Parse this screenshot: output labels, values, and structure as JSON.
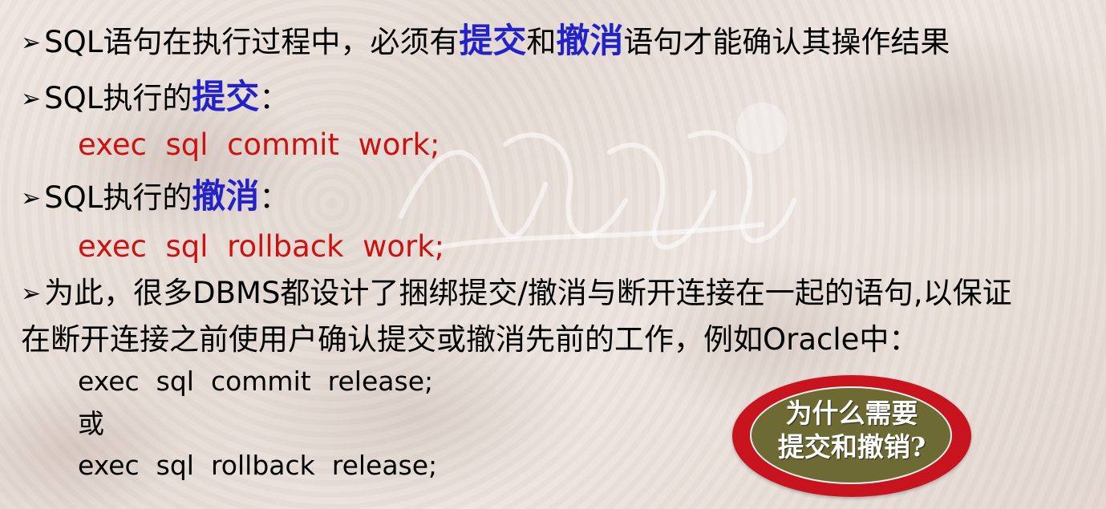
{
  "line1": {
    "bullet": "➢",
    "pre": "SQL语句在执行过程中，必须有",
    "hl1": "提交",
    "mid": "和",
    "hl2": "撤消",
    "post": "语句才能确认其操作结果"
  },
  "line2": {
    "bullet": "➢",
    "pre": "SQL执行的",
    "hl": "提交",
    "post": "："
  },
  "code1": "exec  sql  commit  work;",
  "line3": {
    "bullet": "➢",
    "pre": "SQL执行的",
    "hl": "撤消",
    "post": "："
  },
  "code2": "exec  sql  rollback  work;",
  "line4": {
    "bullet": "➢",
    "text": "为此，很多DBMS都设计了捆绑提交/撤消与断开连接在一起的语句,以保证"
  },
  "line5": {
    "text": "在断开连接之前使用户确认提交或撤消先前的工作，例如Oracle中："
  },
  "code3": "exec  sql  commit  release;",
  "or_text": "或",
  "code4": "exec  sql  rollback  release;",
  "callout": {
    "line1": "为什么需要",
    "line2": "提交和撤销?"
  },
  "colors": {
    "highlight": "#2222c8",
    "code": "#cc1111",
    "callout_outer": "#c8141e",
    "callout_inner": "#6e6a34"
  }
}
